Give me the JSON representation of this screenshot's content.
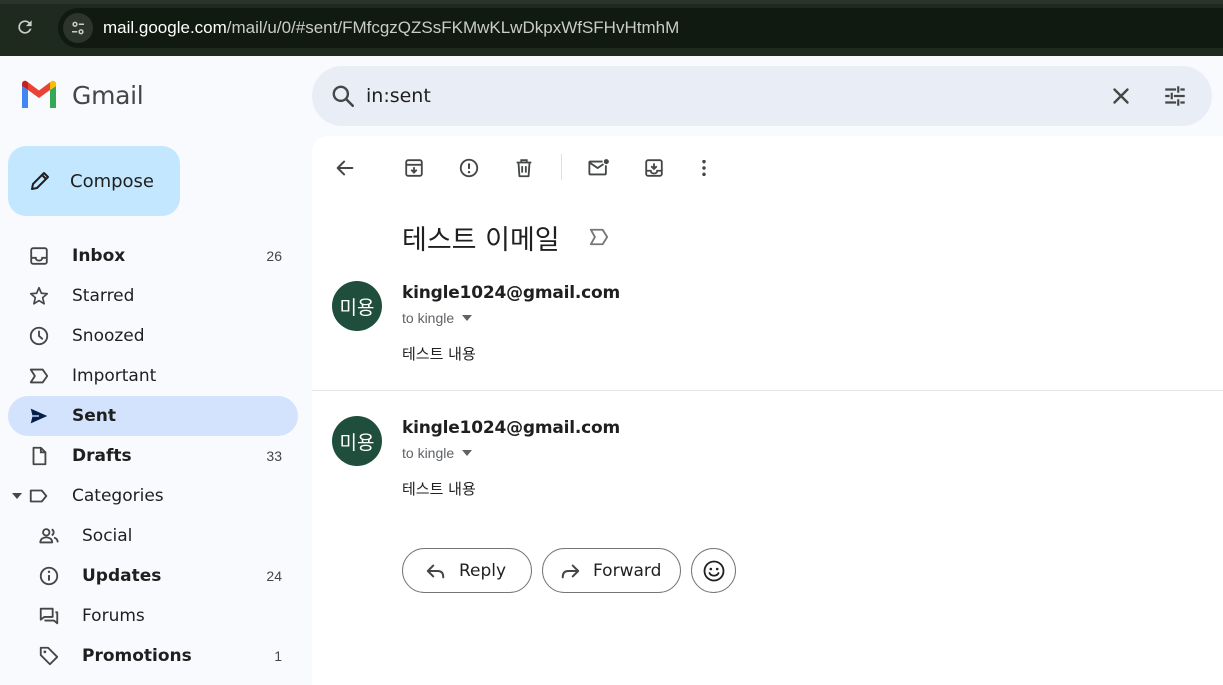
{
  "browser": {
    "url_host": "mail.google.com",
    "url_path": "/mail/u/0/#sent/FMfcgzQZSsFKMwKLwDkpxWfSFHvHtmhM"
  },
  "app": {
    "name": "Gmail"
  },
  "search": {
    "query": "in:sent"
  },
  "compose": {
    "label": "Compose"
  },
  "sidebar": {
    "items": [
      {
        "label": "Inbox",
        "count": "26",
        "icon": "inbox-icon",
        "bold": true
      },
      {
        "label": "Starred",
        "count": "",
        "icon": "star-icon",
        "bold": false
      },
      {
        "label": "Snoozed",
        "count": "",
        "icon": "clock-icon",
        "bold": false
      },
      {
        "label": "Important",
        "count": "",
        "icon": "label-important-icon",
        "bold": false
      },
      {
        "label": "Sent",
        "count": "",
        "icon": "send-icon",
        "bold": true,
        "active": true
      },
      {
        "label": "Drafts",
        "count": "33",
        "icon": "draft-icon",
        "bold": true
      },
      {
        "label": "Categories",
        "count": "",
        "icon": "label-icon",
        "bold": false
      },
      {
        "label": "Social",
        "count": "",
        "icon": "people-icon",
        "bold": false
      },
      {
        "label": "Updates",
        "count": "24",
        "icon": "info-icon",
        "bold": true
      },
      {
        "label": "Forums",
        "count": "",
        "icon": "forum-icon",
        "bold": false
      },
      {
        "label": "Promotions",
        "count": "1",
        "icon": "tag-icon",
        "bold": true
      }
    ]
  },
  "thread": {
    "subject": "테스트 이메일",
    "messages": [
      {
        "avatar": "미용",
        "sender": "kingle1024@gmail.com",
        "recipient": "to kingle",
        "body": "테스트 내용"
      },
      {
        "avatar": "미용",
        "sender": "kingle1024@gmail.com",
        "recipient": "to kingle",
        "body": "테스트 내용"
      }
    ],
    "reply_label": "Reply",
    "forward_label": "Forward"
  },
  "colors": {
    "compose_bg": "#c2e7ff",
    "active_nav_bg": "#d3e3fd",
    "search_bg": "#e9eef6",
    "avatar_bg": "#1f4e3d"
  }
}
